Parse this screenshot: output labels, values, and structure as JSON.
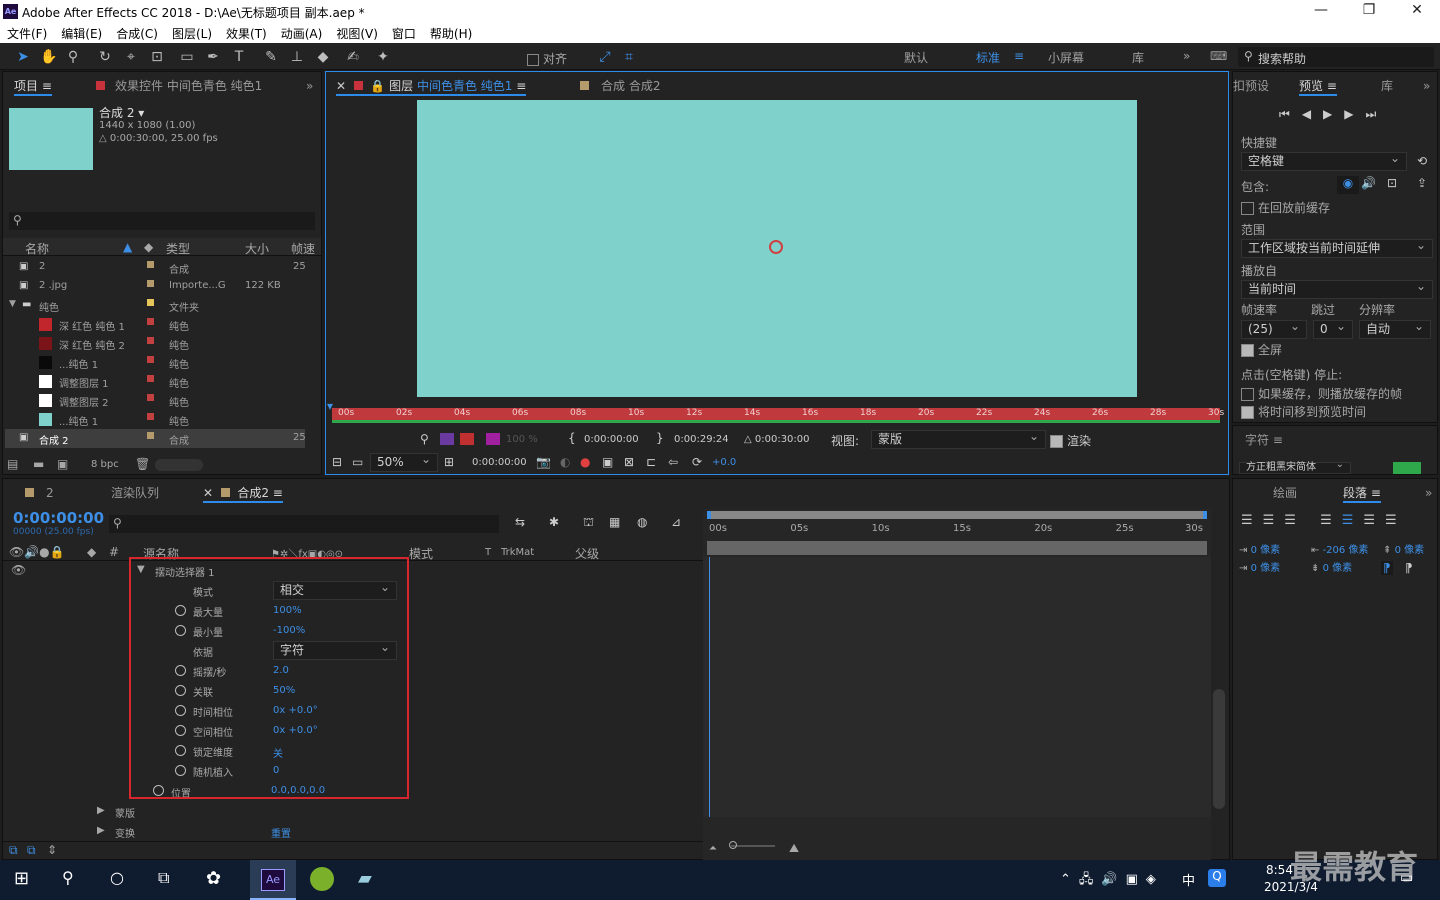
{
  "app": {
    "title": "Adobe After Effects CC 2018 - D:\\Ae\\无标题项目 副本.aep *",
    "logo": "Ae"
  },
  "menu": [
    "文件(F)",
    "编辑(E)",
    "合成(C)",
    "图层(L)",
    "效果(T)",
    "动画(A)",
    "视图(V)",
    "窗口",
    "帮助(H)"
  ],
  "toolbar": {
    "snap_label": "对齐",
    "workspaces": [
      "默认",
      "标准",
      "小屏幕",
      "库"
    ],
    "active_workspace": "标准",
    "search_help": "搜索帮助"
  },
  "project_panel": {
    "tab_project": "项目",
    "tab_effects": "效果控件 中间色青色 纯色1",
    "comp_name": "合成 2",
    "comp_res": "1440 x 1080 (1.00)",
    "comp_duration": "△ 0:00:30:00, 25.00 fps",
    "columns": {
      "name": "名称",
      "type": "类型",
      "size": "大小",
      "fps": "帧速"
    },
    "items": [
      {
        "name": "2",
        "type": "合成",
        "size": "",
        "fps": "25",
        "swatch": "",
        "label": "#b59b6c"
      },
      {
        "name": "2 .jpg",
        "type": "Importe...G",
        "size": "122 KB",
        "fps": "",
        "swatch": "",
        "label": "#b59b6c"
      },
      {
        "name": "纯色",
        "type": "文件夹",
        "size": "",
        "fps": "",
        "swatch": "",
        "label": "#e6c65a"
      },
      {
        "name": "深 红色 纯色 1",
        "type": "纯色",
        "size": "",
        "fps": "",
        "swatch": "#c0262c",
        "label": "#c24040"
      },
      {
        "name": "深 红色 纯色 2",
        "type": "纯色",
        "size": "",
        "fps": "",
        "swatch": "#7a1418",
        "label": "#c24040"
      },
      {
        "name": "...纯色 1",
        "type": "纯色",
        "size": "",
        "fps": "",
        "swatch": "#0a0a0a",
        "label": "#c24040"
      },
      {
        "name": "调整图层 1",
        "type": "纯色",
        "size": "",
        "fps": "",
        "swatch": "#ffffff",
        "label": "#c24040"
      },
      {
        "name": "调整图层 2",
        "type": "纯色",
        "size": "",
        "fps": "",
        "swatch": "#ffffff",
        "label": "#c24040"
      },
      {
        "name": "...纯色 1",
        "type": "纯色",
        "size": "",
        "fps": "",
        "swatch": "#7fd1cc",
        "label": "#c24040"
      },
      {
        "name": "合成 2",
        "type": "合成",
        "size": "",
        "fps": "25",
        "swatch": "",
        "label": "#b59b6c"
      }
    ],
    "bpc": "8 bpc"
  },
  "viewer": {
    "tab_layer": "图层",
    "tab_layer_name": "中间色青色 纯色1",
    "tab_comp": "合成 合成2",
    "solid_color": "#7fd1cc",
    "ruler": [
      "00s",
      "02s",
      "04s",
      "06s",
      "08s",
      "10s",
      "12s",
      "14s",
      "16s",
      "18s",
      "20s",
      "22s",
      "24s",
      "26s",
      "28s",
      "30s"
    ],
    "opacity": "100 %",
    "time_in": "0:00:00:00",
    "time_out": "0:00:29:24",
    "duration": "△ 0:00:30:00",
    "view_label": "视图:",
    "view_value": "蒙版",
    "render_label": "渲染",
    "zoom": "50%",
    "current_time": "0:00:00:00",
    "exposure": "+0.0"
  },
  "preview_panel": {
    "tab_presets": "扣预设",
    "tab_preview": "预览",
    "tab_library": "库",
    "shortcut_label": "快捷键",
    "shortcut_value": "空格键",
    "include_label": "包含:",
    "cache_label": "在回放前缓存",
    "range_label": "范围",
    "range_value": "工作区域按当前时间延伸",
    "playfrom_label": "播放自",
    "playfrom_value": "当前时间",
    "fps_label": "帧速率",
    "skip_label": "跳过",
    "res_label": "分辨率",
    "fps_value": "(25)",
    "skip_value": "0",
    "res_value": "自动",
    "fullscreen_label": "全屏",
    "stop_label": "点击(空格键) 停止:",
    "stop_opt1": "如果缓存，则播放缓存的帧",
    "stop_opt2": "将时间移到预览时间",
    "char_tab": "字符",
    "font_value": "方正粗黑宋简体"
  },
  "paragraph_panel": {
    "tab_paint": "绘画",
    "tab_paragraph": "段落",
    "indent_left": "0 像素",
    "indent_right": "-206 像素",
    "space_before": "0 像素",
    "first_line": "0 像素",
    "space_after": "0 像素"
  },
  "timeline": {
    "tab_2": "2",
    "tab_render": "渲染队列",
    "tab_comp": "合成2",
    "timecode": "0:00:00:00",
    "timecode_sub": "00000 (25.00 fps)",
    "col_source": "源名称",
    "col_mode": "模式",
    "col_t": "T",
    "col_trkmat": "TrkMat",
    "col_parent": "父级",
    "selector": "摆动选择器 1",
    "properties": [
      {
        "name": "模式",
        "value": "相交",
        "kind": "dropdown"
      },
      {
        "name": "最大量",
        "value": "100%",
        "kind": "value"
      },
      {
        "name": "最小量",
        "value": "-100%",
        "kind": "value"
      },
      {
        "name": "依据",
        "value": "字符",
        "kind": "dropdown"
      },
      {
        "name": "摇摆/秒",
        "value": "2.0",
        "kind": "value"
      },
      {
        "name": "关联",
        "value": "50%",
        "kind": "value"
      },
      {
        "name": "时间相位",
        "value": "0x +0.0°",
        "kind": "value"
      },
      {
        "name": "空间相位",
        "value": "0x +0.0°",
        "kind": "value"
      },
      {
        "name": "锁定维度",
        "value": "关",
        "kind": "value"
      },
      {
        "name": "随机植入",
        "value": "0",
        "kind": "value"
      }
    ],
    "position_label": "位置",
    "position_value": "0.0,0.0,0.0",
    "mask_label": "蒙版",
    "transform_label": "变换",
    "transform_value": "重置",
    "ruler": [
      "00s",
      "05s",
      "10s",
      "15s",
      "20s",
      "25s",
      "30s"
    ]
  },
  "taskbar": {
    "time": "8:54",
    "date": "2021/3/4",
    "ime": "中",
    "watermark": "最需教育",
    "ae": "Ae"
  }
}
